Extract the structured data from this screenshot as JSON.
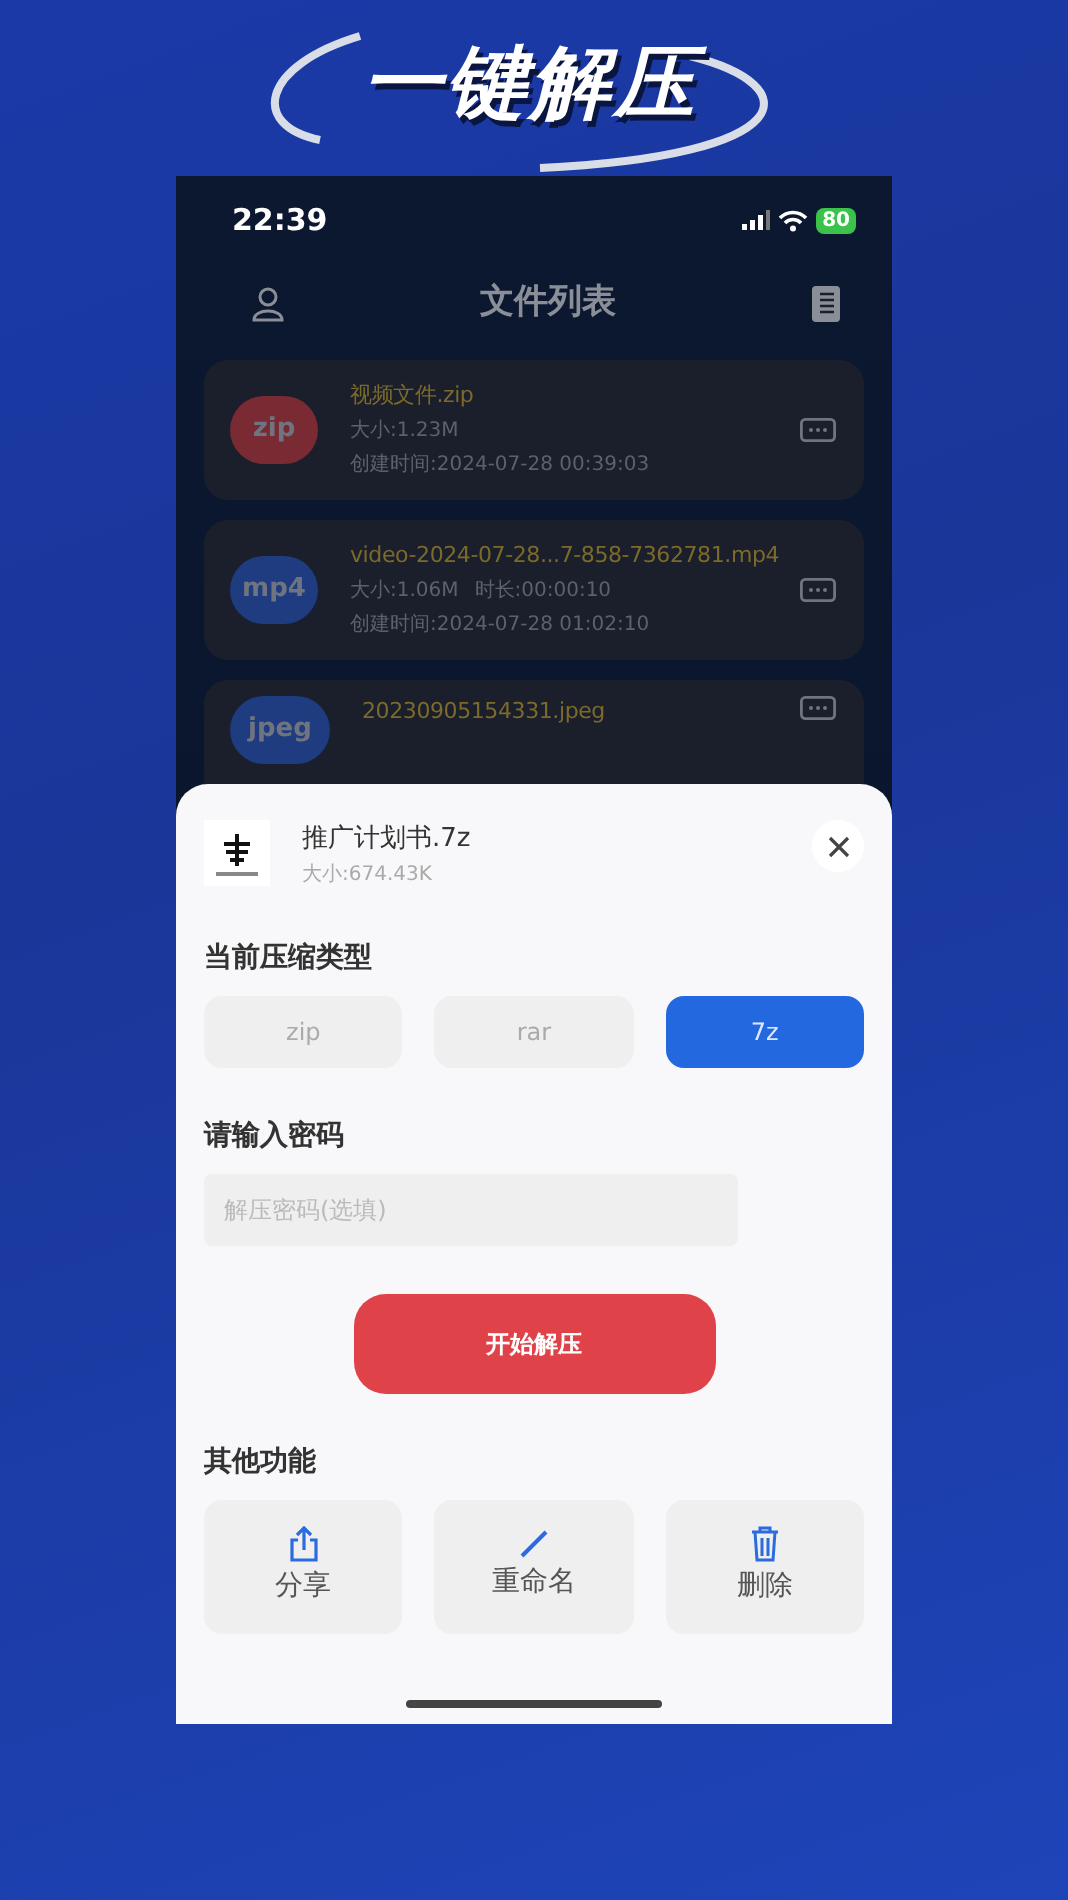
{
  "banner": {
    "title": "一键解压"
  },
  "status_bar": {
    "time": "22:39",
    "battery": "80"
  },
  "header": {
    "title": "文件列表"
  },
  "files": [
    {
      "badge": "zip",
      "color": "#7a2a33",
      "name": "视频文件.zip",
      "size": "大小:1.23M",
      "created": "创建时间:2024-07-28 00:39:03"
    },
    {
      "badge": "mp4",
      "color": "#1f3c80",
      "name": "video-2024-07-28...7-858-7362781.mp4",
      "size": "大小:1.06M",
      "duration": "时长:00:00:10",
      "created": "创建时间:2024-07-28 01:02:10"
    },
    {
      "badge": "jpeg",
      "color": "#1f3c80",
      "name": "20230905154331.jpeg"
    }
  ],
  "sheet": {
    "file_name": "推广计划书.7z",
    "file_size": "大小:674.43K",
    "type_label": "当前压缩类型",
    "types": [
      {
        "label": "zip",
        "selected": false
      },
      {
        "label": "rar",
        "selected": false
      },
      {
        "label": "7z",
        "selected": true
      }
    ],
    "password_label": "请输入密码",
    "password": {
      "placeholder": "解压密码(选填)"
    },
    "start_button": "开始解压",
    "other_label": "其他功能",
    "actions": [
      {
        "kind": "share",
        "label": "分享"
      },
      {
        "kind": "rename",
        "label": "重命名"
      },
      {
        "kind": "delete",
        "label": "删除"
      }
    ]
  }
}
